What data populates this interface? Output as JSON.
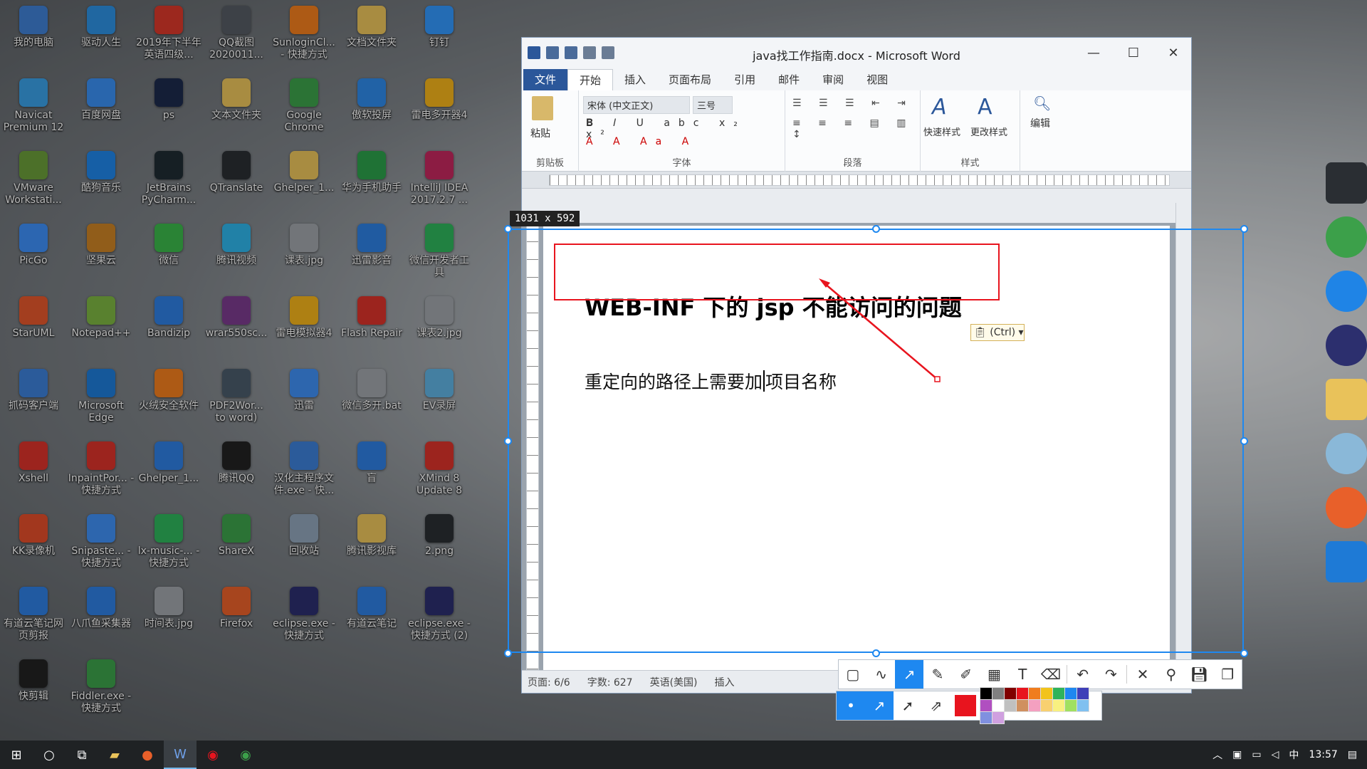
{
  "desktop": {
    "icons": [
      {
        "label": "我的电脑",
        "color": "#3f7fd1"
      },
      {
        "label": "驱动人生",
        "color": "#2d8fe0"
      },
      {
        "label": "2019年下半年英语四级...",
        "color": "#d9382a"
      },
      {
        "label": "QQ截图2020011...",
        "color": "#555b63"
      },
      {
        "label": "SunloginCl... - 快捷方式",
        "color": "#f07d1e"
      },
      {
        "label": "文档文件夹",
        "color": "#e9c25a"
      },
      {
        "label": "钉钉",
        "color": "#3296fa"
      },
      {
        "label": "Navicat Premium 12",
        "color": "#3a9ee4"
      },
      {
        "label": "百度网盘",
        "color": "#3a8ef0"
      },
      {
        "label": "ps",
        "color": "#1d2a4c"
      },
      {
        "label": "文本文件夹",
        "color": "#e9c25a"
      },
      {
        "label": "Google Chrome",
        "color": "#3ca04a"
      },
      {
        "label": "傲软投屏",
        "color": "#2f88e6"
      },
      {
        "label": "雷电多开器4",
        "color": "#f2b21b"
      },
      {
        "label": "VMware Workstati...",
        "color": "#6a9b3a"
      },
      {
        "label": "酷狗音乐",
        "color": "#1f84e6"
      },
      {
        "label": "JetBrains PyCharm...",
        "color": "#1f2c33"
      },
      {
        "label": "QTranslate",
        "color": "#2a2e33"
      },
      {
        "label": "Ghelper_1...",
        "color": "#e9c25a"
      },
      {
        "label": "华为手机助手",
        "color": "#2c9f4a"
      },
      {
        "label": "IntelliJ IDEA 2017.2.7 ...",
        "color": "#c2275d"
      },
      {
        "label": "PicGo",
        "color": "#3d8ef5"
      },
      {
        "label": "坚果云",
        "color": "#c98124"
      },
      {
        "label": "微信",
        "color": "#3bb64a"
      },
      {
        "label": "腾讯视频",
        "color": "#2fb3e8"
      },
      {
        "label": "课表.jpg",
        "color": "#9ea3a8"
      },
      {
        "label": "迅雷影音",
        "color": "#2d7ee0"
      },
      {
        "label": "微信开发者工具",
        "color": "#2fb35a"
      },
      {
        "label": "StarUML",
        "color": "#e2562b"
      },
      {
        "label": "Notepad++",
        "color": "#7cb342"
      },
      {
        "label": "Bandizip",
        "color": "#2f7de0"
      },
      {
        "label": "wrar550sc...",
        "color": "#7b3b8c"
      },
      {
        "label": "雷电模拟器4",
        "color": "#f2b21b"
      },
      {
        "label": "Flash Repair",
        "color": "#d8332a"
      },
      {
        "label": "课表2.jpg",
        "color": "#9ea3a8"
      },
      {
        "label": "抓码客户端",
        "color": "#3c7fd6"
      },
      {
        "label": "Microsoft Edge",
        "color": "#1e7ad6"
      },
      {
        "label": "火绒安全软件",
        "color": "#f07d1e"
      },
      {
        "label": "PDF2Wor... to word)",
        "color": "#4a5a6a"
      },
      {
        "label": "迅雷",
        "color": "#3f8ef2"
      },
      {
        "label": "微信多开.bat",
        "color": "#9ea3a8"
      },
      {
        "label": "EV录屏",
        "color": "#5fb0e0"
      },
      {
        "label": "Xshell",
        "color": "#d8332a"
      },
      {
        "label": "InpaintPor... - 快捷方式",
        "color": "#d8332a"
      },
      {
        "label": "Ghelper_1...",
        "color": "#2f7de0"
      },
      {
        "label": "腾讯QQ",
        "color": "#222222"
      },
      {
        "label": "汉化主程序文件.exe - 快...",
        "color": "#3c7fd6"
      },
      {
        "label": "盲",
        "color": "#2f7de0"
      },
      {
        "label": "XMind 8 Update 8",
        "color": "#d8332a"
      },
      {
        "label": "KK录像机",
        "color": "#e14d2a"
      },
      {
        "label": "Snipaste... - 快捷方式",
        "color": "#3f8ef2"
      },
      {
        "label": "lx-music-... - 快捷方式",
        "color": "#2fb35a"
      },
      {
        "label": "ShareX",
        "color": "#3ca04a"
      },
      {
        "label": "回收站",
        "color": "#8fa3b8"
      },
      {
        "label": "腾讯影视库",
        "color": "#e9c25a"
      },
      {
        "label": "2.png",
        "color": "#2a2e33"
      },
      {
        "label": "有道云笔记网页剪报",
        "color": "#2f7de0"
      },
      {
        "label": "八爪鱼采集器",
        "color": "#2f7de0"
      },
      {
        "label": "时间表.jpg",
        "color": "#9ea3a8"
      },
      {
        "label": "Firefox",
        "color": "#e8602a"
      },
      {
        "label": "eclipse.exe - 快捷方式",
        "color": "#2c2f6e"
      },
      {
        "label": "有道云笔记",
        "color": "#2f7de0"
      },
      {
        "label": "eclipse.exe - 快捷方式 (2)",
        "color": "#2c2f6e"
      },
      {
        "label": "快剪辑",
        "color": "#222222"
      },
      {
        "label": "Fiddler.exe - 快捷方式",
        "color": "#3ca04a"
      }
    ]
  },
  "word": {
    "title": "java找工作指南.docx - Microsoft Word",
    "tabs": [
      "文件",
      "开始",
      "插入",
      "页面布局",
      "引用",
      "邮件",
      "审阅",
      "视图"
    ],
    "active_tab": "开始",
    "ribbon": {
      "font_name": "宋体 (中文正文)",
      "font_size": "三号",
      "groups": [
        "剪贴板",
        "字体",
        "段落",
        "样式"
      ],
      "paste_label": "粘贴",
      "quick_styles_label": "快速样式",
      "change_styles_label": "更改样式",
      "edit_label": "编辑"
    },
    "document": {
      "heading": "WEB-INF 下的 jsp 不能访问的问题",
      "body_before_cursor": "重定向的路径上需要加",
      "body_after_cursor": "项目名称",
      "paste_options": "(Ctrl)"
    },
    "status": {
      "page": "页面: 6/6",
      "words": "字数: 627",
      "language": "英语(美国)",
      "mode": "插入"
    }
  },
  "screenshot_tool": {
    "size_label": "1031 x 592",
    "accent_color": "#1e88f0",
    "annotation_color": "#e8141e",
    "tools": [
      "rectangle-icon",
      "curve-icon",
      "arrow-icon",
      "pencil-icon",
      "marker-icon",
      "mosaic-icon",
      "text-icon",
      "eraser-icon",
      "undo-icon",
      "redo-icon",
      "close-icon",
      "pin-icon",
      "save-icon",
      "copy-icon"
    ],
    "active_tool": "arrow-icon",
    "arrow_styles": [
      "dot-icon",
      "arrow-style-1-icon",
      "arrow-style-2-icon",
      "arrow-style-3-icon"
    ],
    "current_color": "#e8141e",
    "palette": [
      "#000000",
      "#808080",
      "#800000",
      "#e8141e",
      "#f07d1e",
      "#f2c31b",
      "#2fb35a",
      "#1e88f0",
      "#3f3fb8",
      "#b04fc0",
      "#ffffff",
      "#c0c0c0",
      "#d09060",
      "#f4a0c0",
      "#f8d070",
      "#f8f080",
      "#a0e060",
      "#80c0f0",
      "#8090e0",
      "#d0a0e0"
    ]
  },
  "taskbar": {
    "clock": "13:57",
    "ime": "中"
  }
}
